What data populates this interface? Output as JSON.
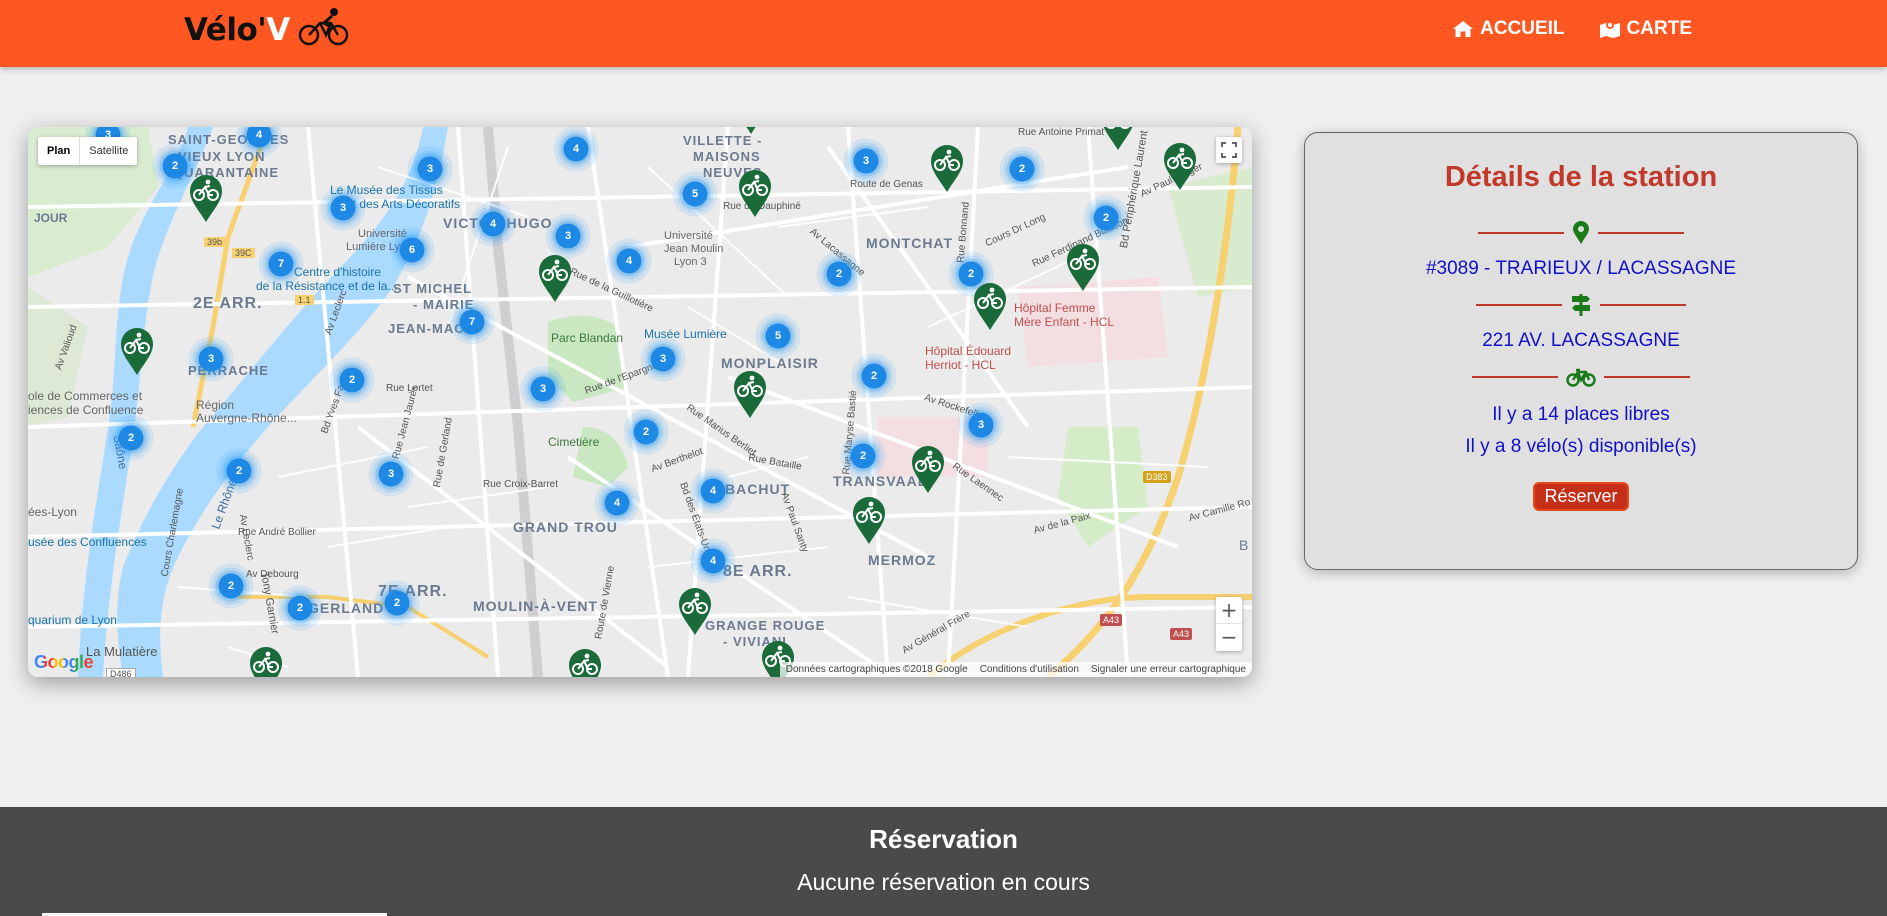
{
  "header": {
    "logo": {
      "main": "Vélo'",
      "accent": "V"
    },
    "nav": [
      {
        "label": "ACCUEIL",
        "icon": "home-icon"
      },
      {
        "label": "CARTE",
        "icon": "map-icon"
      }
    ]
  },
  "map": {
    "type_controls": [
      "Plan",
      "Satellite"
    ],
    "google_logo": "Google",
    "attribution": "Données cartographiques ©2018 Google",
    "terms": "Conditions d'utilisation",
    "report": "Signaler une erreur cartographique",
    "zoom_in": "+",
    "zoom_out": "−",
    "road_labels": [
      "D383",
      "A43",
      "A43",
      "D486",
      "39b",
      "39C",
      "1.1"
    ],
    "labels": [
      "SAINT-GEORGES",
      "VIEUX LYON",
      "QUARANTAINE",
      "JOUR",
      "2E ARR.",
      "PERRACHE",
      "VICTOR HUGO",
      "ST MICHEL",
      "- MAIRIE",
      "JEAN-MACÉ",
      "Parc Blandan",
      "MONPLAISIR",
      "MONTCHAT",
      "VILLETTE -",
      "MAISONS",
      "NEUVES",
      "TRANSVAAL",
      "MERMOZ",
      "GRAND TROU",
      "BACHUT",
      "8E ARR.",
      "7E ARR.",
      "GERLAND",
      "MOULIN-À-VENT",
      "GRANGE ROUGE",
      "- VIVIANI",
      "La Mulatière",
      "Le Musée des Tissus",
      "et des Arts Décoratifs",
      "Université",
      "Lumière Lyon 2",
      "Centre d'histoire",
      "de la Résistance et de la...",
      "Musée Lumière",
      "Hôpital Femme",
      "Mère Enfant - HCL",
      "Hôpital Édouard",
      "Herriot - HCL",
      "Cimetière",
      "Région",
      "Auvergne-Rhône...",
      "ole de Commerces et",
      "iences de Confluence",
      "ées-Lyon",
      "usée des Confluences",
      "quarium de Lyon",
      "Université",
      "Jean Moulin",
      "Lyon 3",
      "Rue du Dauphiné",
      "Route de Genas",
      "Cours Dr Long",
      "Rue Ferdinand Buisson",
      "Av Paul Kruger",
      "Bd Périphérique Laurent Bonnevay",
      "Av Rockefeller",
      "Rue Marius Berliet",
      "Rue Bataille",
      "Av Berthelot",
      "Rue Croix-Barret",
      "Rue André Bollier",
      "Av Debourg",
      "Bd des États-Unis",
      "Av Paul Santy",
      "Av Général Frère",
      "Av de la Paix",
      "Av Camille Ro",
      "Rue Lortet",
      "Rue de Gerland",
      "Cours Charlemagne",
      "Av Lacassagne",
      "Rue de la Guillotière",
      "Rue de l'Epargne",
      "Av Leclerc",
      "Av Valioud",
      "Le Rhône",
      "Saône",
      "Av Leclerc",
      "Bd Yves Farge",
      "Rue Jean Jaurès",
      "Rue Antoine Primat",
      "Rue Laennec",
      "Rue Maryse Bastié",
      "Route de Vienne",
      "Rue Bonnand",
      "B",
      "Tony Garnier"
    ],
    "clusters": [
      {
        "count": "3"
      },
      {
        "count": "4"
      },
      {
        "count": "2"
      },
      {
        "count": "3"
      },
      {
        "count": "3"
      },
      {
        "count": "4"
      },
      {
        "count": "4"
      },
      {
        "count": "3"
      },
      {
        "count": "6"
      },
      {
        "count": "7"
      },
      {
        "count": "5"
      },
      {
        "count": "3"
      },
      {
        "count": "2"
      },
      {
        "count": "2"
      },
      {
        "count": "2"
      },
      {
        "count": "2"
      },
      {
        "count": "7"
      },
      {
        "count": "4"
      },
      {
        "count": "5"
      },
      {
        "count": "3"
      },
      {
        "count": "3"
      },
      {
        "count": "3"
      },
      {
        "count": "2"
      },
      {
        "count": "2"
      },
      {
        "count": "2"
      },
      {
        "count": "2"
      },
      {
        "count": "3"
      },
      {
        "count": "3"
      },
      {
        "count": "2"
      },
      {
        "count": "4"
      },
      {
        "count": "2"
      },
      {
        "count": "4"
      },
      {
        "count": "4"
      },
      {
        "count": "2"
      },
      {
        "count": "2"
      }
    ],
    "markers": 17
  },
  "details": {
    "title": "Détails de la station",
    "station": "#3089 - TRARIEUX / LACASSAGNE",
    "address": "221 AV. LACASSAGNE",
    "places": "Il y a 14 places libres",
    "bikes": "Il y a 8 vélo(s) disponible(s)",
    "button": "Réserver",
    "colors": {
      "title": "#c0392b",
      "text": "#1010c8",
      "icon": "#1a7a1a"
    }
  },
  "footer": {
    "title": "Réservation",
    "status": "Aucune réservation en cours"
  },
  "colors": {
    "brand": "#ff5722",
    "marker": "#1b6b3a",
    "cluster": "#1e88e5",
    "footer": "#4a4a4a"
  }
}
